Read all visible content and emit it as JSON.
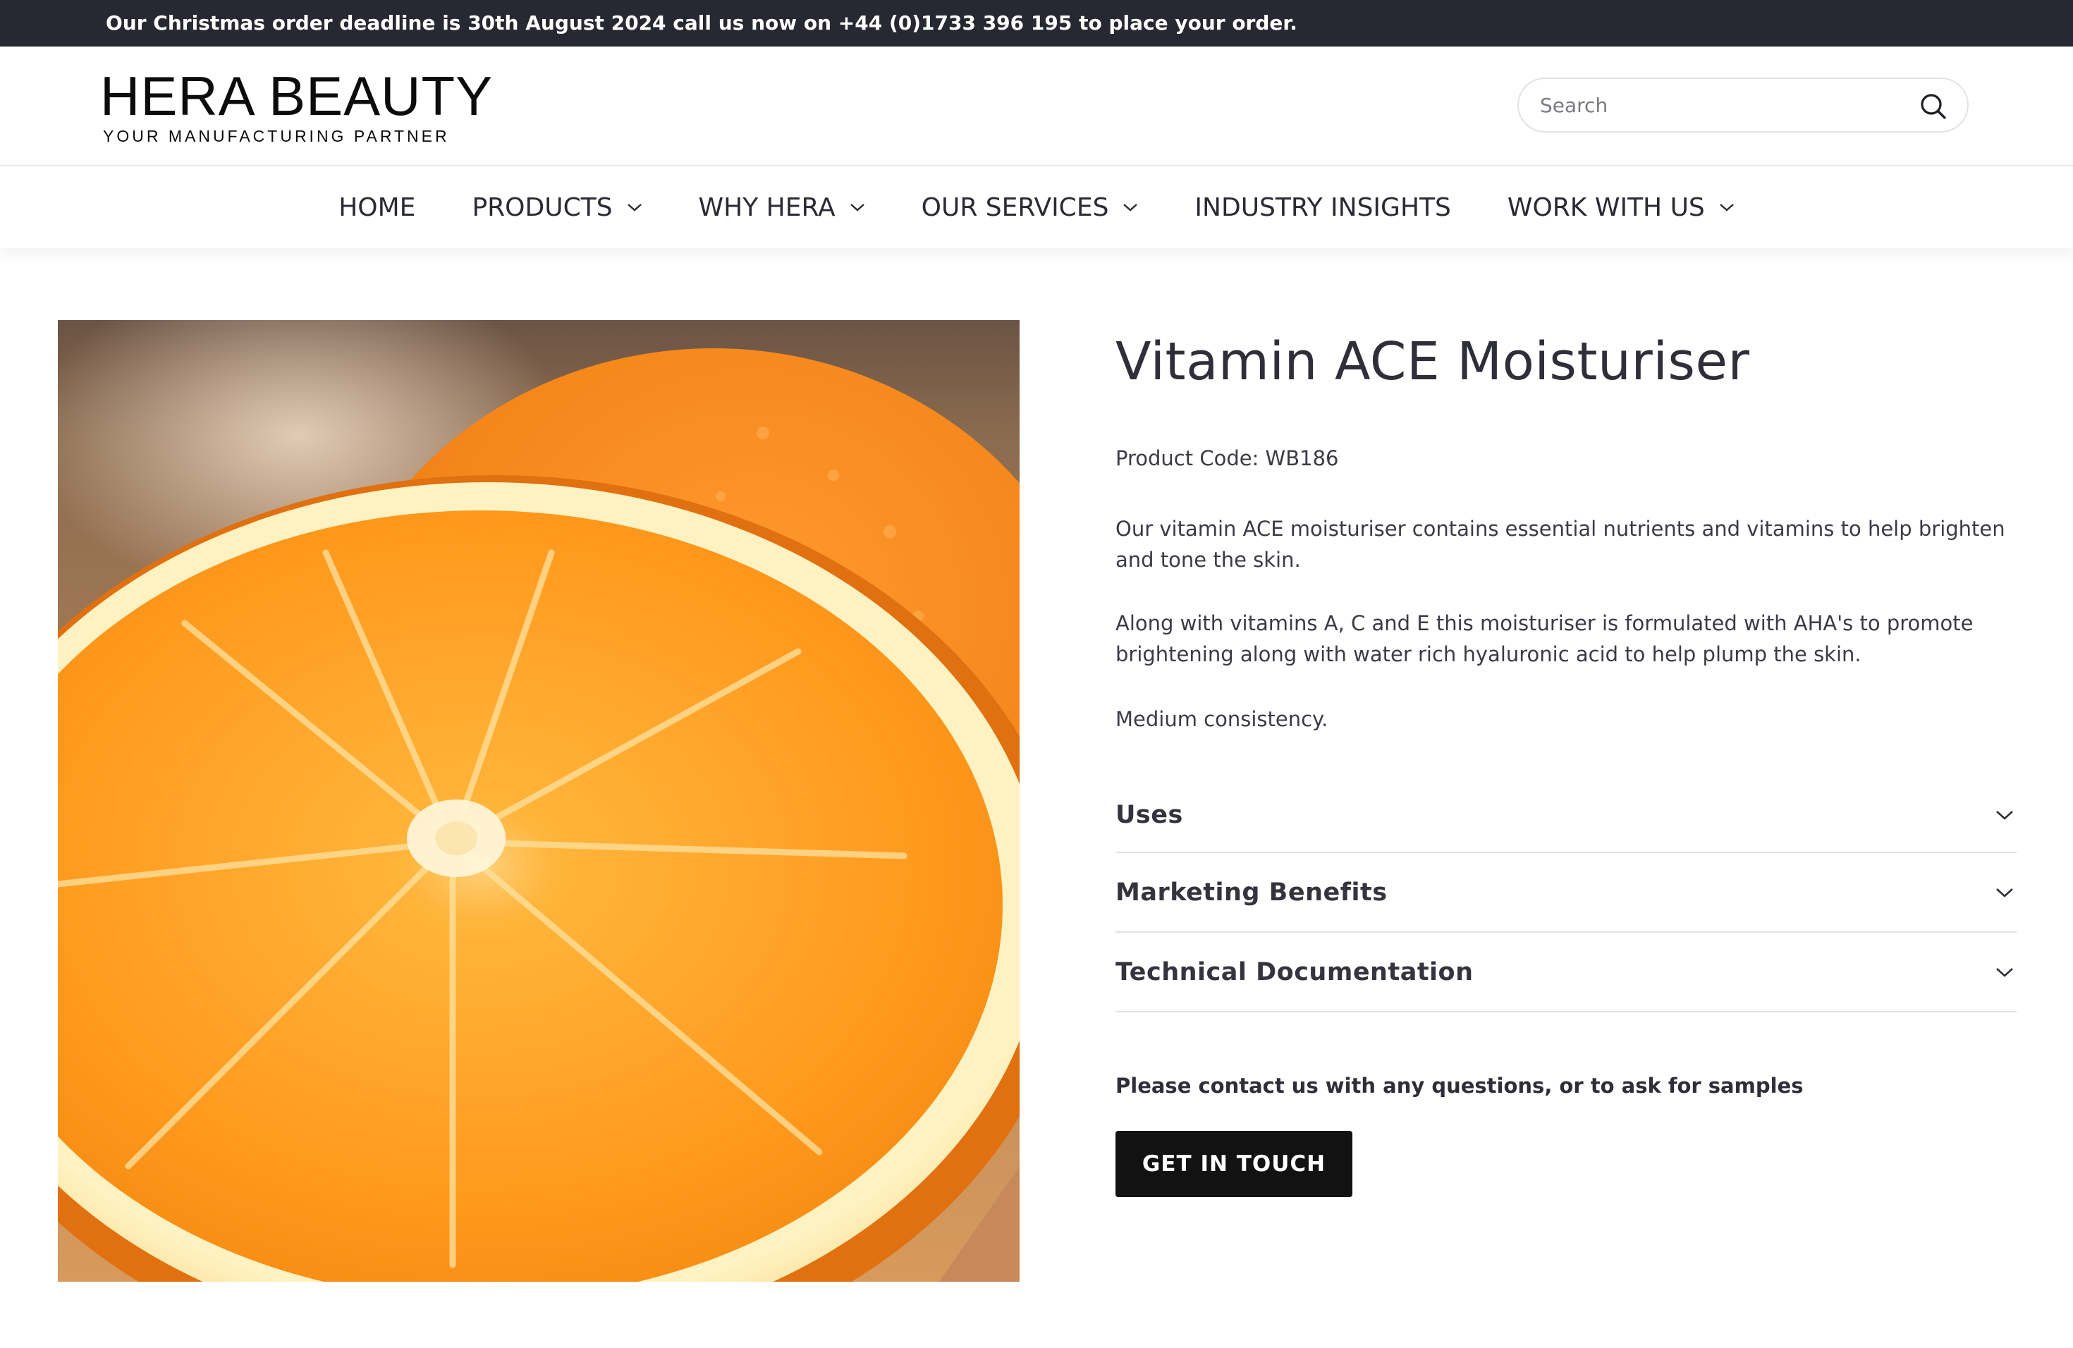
{
  "announcement": {
    "text": "Our Christmas order deadline is 30th August 2024 call us now on +44 (0)1733 396 195 to place your order."
  },
  "header": {
    "logo_main": "HERA BEAUTY",
    "logo_tagline": "YOUR MANUFACTURING PARTNER",
    "search_placeholder": "Search",
    "search_icon": "search-icon"
  },
  "nav": {
    "items": [
      {
        "label": "HOME",
        "has_dropdown": false
      },
      {
        "label": "PRODUCTS",
        "has_dropdown": true
      },
      {
        "label": "WHY HERA",
        "has_dropdown": true
      },
      {
        "label": "OUR SERVICES",
        "has_dropdown": true
      },
      {
        "label": "INDUSTRY INSIGHTS",
        "has_dropdown": false
      },
      {
        "label": "WORK WITH US",
        "has_dropdown": true
      }
    ]
  },
  "product": {
    "image_subject": "orange-slice-photo",
    "title": "Vitamin ACE Moisturiser",
    "code": "Product Code: WB186",
    "description": [
      "Our vitamin ACE moisturiser contains essential nutrients and vitamins to help brighten and tone the skin.",
      "Along with vitamins A, C and E this moisturiser is formulated with AHA's to promote brightening along with water rich hyaluronic acid to help plump the skin.",
      "Medium consistency."
    ],
    "accordion": [
      {
        "label": "Uses"
      },
      {
        "label": "Marketing Benefits"
      },
      {
        "label": "Technical Documentation"
      }
    ],
    "contact_note": "Please contact us with any questions, or to ask for samples",
    "cta_label": "GET IN TOUCH"
  },
  "colors": {
    "announcement_bg": "#272832",
    "text_dark": "#2f2f39",
    "button_bg": "#121212",
    "orange": "#f5901c"
  }
}
